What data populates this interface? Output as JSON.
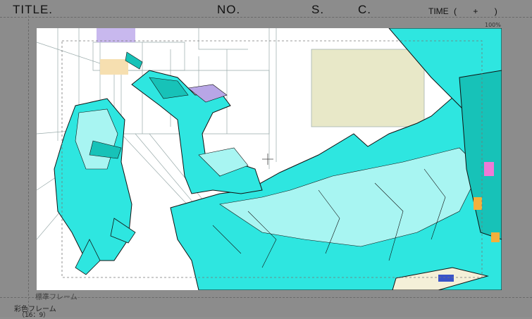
{
  "header": {
    "title_label": "TITLE.",
    "no_label": "NO.",
    "s_label": "S.",
    "c_label": "C.",
    "time_label": "TIME",
    "time_open": "(",
    "time_plus": "+",
    "time_close": ")"
  },
  "frame_labels": {
    "standard_frame": "標準フレーム",
    "color_frame": "彩色フレーム",
    "aspect_ratio": "（16：9）",
    "corner_mark": "100%"
  },
  "colors": {
    "cyan": "#2ee6e0",
    "light_cyan": "#a8f5f2",
    "teal": "#17c2b8",
    "purple": "#b8a6e6",
    "pink": "#ee7ad6",
    "orange": "#f2b03c",
    "beige": "#e8e8c8",
    "line": "#111111",
    "sheet_gray": "#8c8c8c"
  }
}
